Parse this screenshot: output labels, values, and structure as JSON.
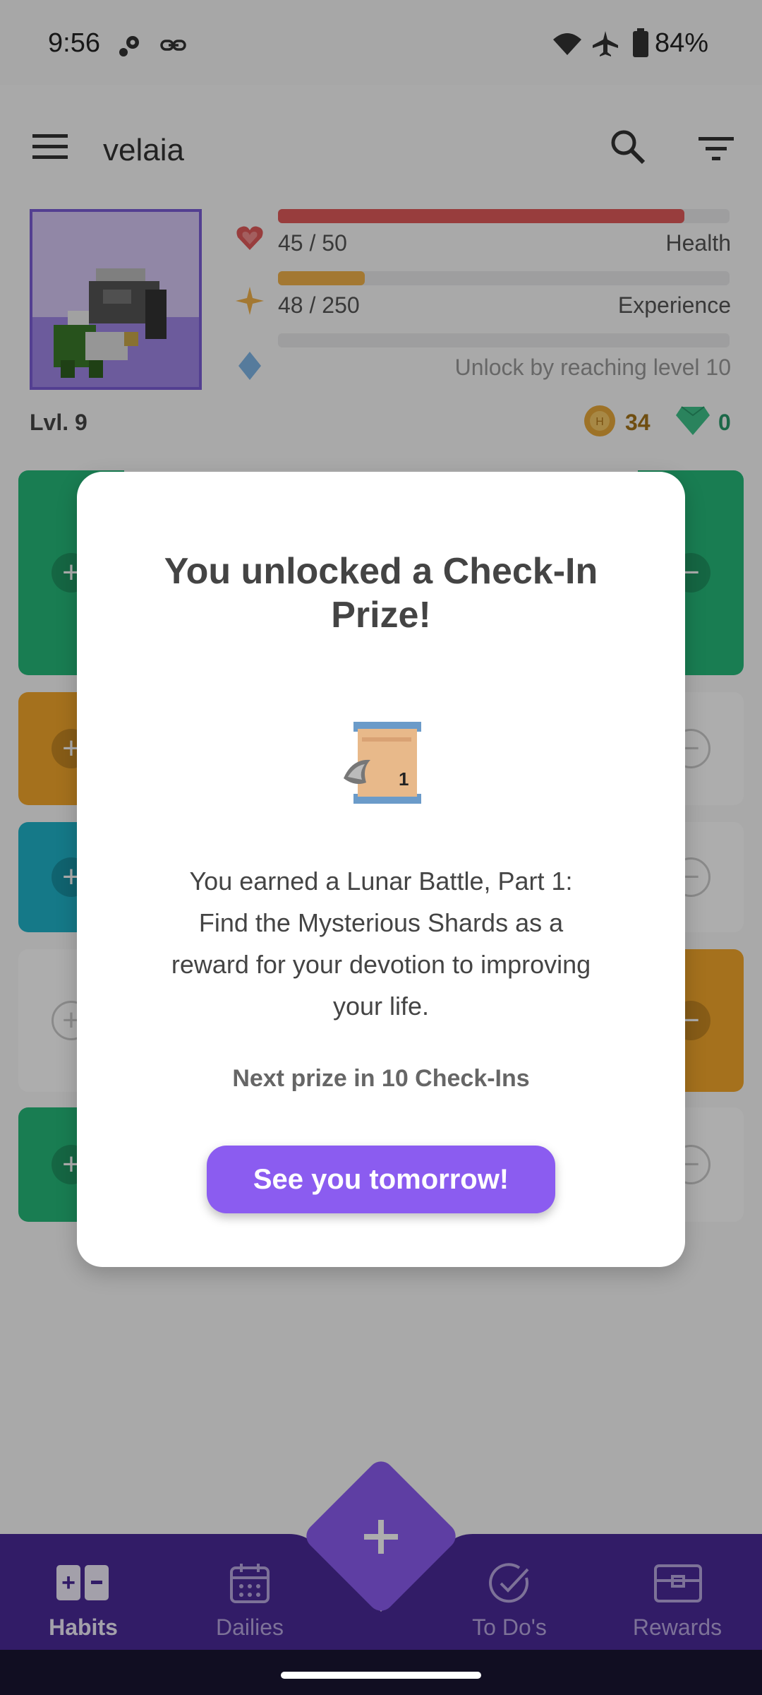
{
  "status_bar": {
    "time": "9:56",
    "battery": "84%"
  },
  "app_bar": {
    "username": "velaia"
  },
  "stats": {
    "health": {
      "text": "45 / 50",
      "label": "Health",
      "fraction": 0.9
    },
    "experience": {
      "text": "48 / 250",
      "label": "Experience",
      "fraction": 0.192
    },
    "mana": {
      "text": "Unlock by reaching level 10"
    },
    "level": "Lvl. 9",
    "gold": "34",
    "gems": "0"
  },
  "dialog": {
    "title": "You unlocked a Check-In Prize!",
    "body": "You earned a Lunar Battle, Part 1: Find the Mysterious Shards as a reward for your devotion to improving your life.",
    "next": "Next prize in 10 Check-Ins",
    "button": "See you tomorrow!"
  },
  "bottom_nav": {
    "tabs": [
      {
        "label": "Habits"
      },
      {
        "label": "Dailies"
      },
      {
        "label": "To Do's"
      },
      {
        "label": "Rewards"
      }
    ]
  },
  "colors": {
    "health": "#e05a5a",
    "experience": "#f0b24a",
    "primary": "#8b5cf0",
    "nav": "#4b2a99"
  }
}
